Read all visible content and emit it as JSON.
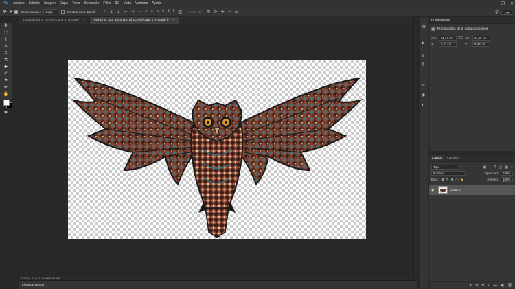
{
  "app": {
    "logo": "Ps"
  },
  "menu": [
    "Archivo",
    "Edición",
    "Imagen",
    "Capa",
    "Texto",
    "Selección",
    "Filtro",
    "3D",
    "Vista",
    "Ventana",
    "Ayuda"
  ],
  "window_controls": [
    "—",
    "❐",
    "✕"
  ],
  "options": {
    "auto_select_label": "Selec. autom.:",
    "auto_select_value": "Capa",
    "transform_label": "Mostrar contr. transf.",
    "mode_3d": "Modo 3D:"
  },
  "tabs": [
    {
      "label": "Tutorial.psd al 18,3% (Capa 3, RGB/8*)",
      "active": false
    },
    {
      "label": "owl-1791700_1920.png al 113% (Capa 0, RGB/8*) *",
      "active": true
    }
  ],
  "status": {
    "zoom": "113,1%",
    "doc": "Doc: 1,19 MB/1,59 MB"
  },
  "timeline": {
    "label": "Línea de tiempo"
  },
  "properties": {
    "title": "Propiedades",
    "subtitle": "Propiedades de la capa de píxeles",
    "width_label": "An.:",
    "width_value": "21,17 cm",
    "link_label": "GO",
    "height_label": "Al.:",
    "height_value": "11,96 cm",
    "x_label": "X:",
    "x_value": "0,42 cm",
    "y_label": "Y:",
    "y_value": "0,48 cm"
  },
  "layers": {
    "tabs": [
      "Capas",
      "Canales"
    ],
    "filter_label": "Tipo",
    "blend_mode": "Normal",
    "opacity_label": "Opacidad:",
    "opacity_value": "100%",
    "lock_label": "Bloq.:",
    "fill_label": "Relleno:",
    "fill_value": "100%",
    "layer_name": "Capa 0"
  },
  "colors": {
    "foreground": "#ffffff",
    "background": "#000000",
    "accent": "#31a8ff"
  }
}
